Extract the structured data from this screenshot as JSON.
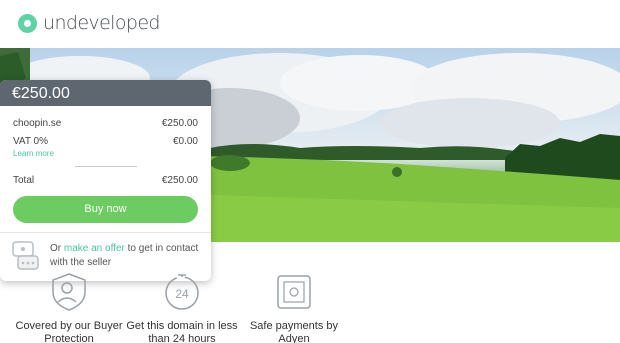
{
  "brand": {
    "name": "undeveloped",
    "accent": "#5fd3a6"
  },
  "card": {
    "price_header": "€250.00",
    "rows": [
      {
        "label": "choopin.se",
        "value": "€250.00"
      },
      {
        "label": "VAT 0%",
        "value": "€0.00"
      }
    ],
    "learn_more": "Learn more",
    "total_label": "Total",
    "total_value": "€250.00",
    "buy_button": "Buy now",
    "offer_prefix": "Or",
    "offer_link": "make an offer",
    "offer_suffix": "to get in contact with the seller"
  },
  "features": [
    {
      "label": "Covered by our Buyer Protection",
      "icon": "shield-person-icon"
    },
    {
      "label": "Get this domain in less than 24 hours",
      "icon": "clock-24-icon"
    },
    {
      "label": "Safe payments by Adyen",
      "icon": "safe-icon"
    }
  ],
  "colors": {
    "button": "#6ccb61",
    "link": "#48c79a",
    "card_header": "#5e6670"
  }
}
